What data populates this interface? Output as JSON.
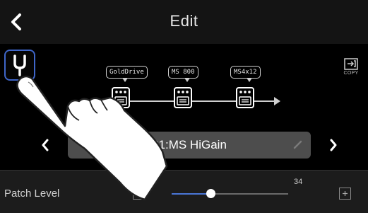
{
  "header": {
    "title": "Edit"
  },
  "copy": {
    "label": "COPY"
  },
  "effects": [
    {
      "label": "GoldDrive"
    },
    {
      "label": "MS 800"
    },
    {
      "label": "MS4x12"
    }
  ],
  "patch": {
    "name": "01:MS HiGain"
  },
  "patch_level": {
    "label": "Patch Level",
    "value": "34",
    "fraction": 0.34
  },
  "colors": {
    "accent": "#3f66c9",
    "slider_fill": "#4a76d6",
    "patch_bar": "#4d4d4d"
  }
}
